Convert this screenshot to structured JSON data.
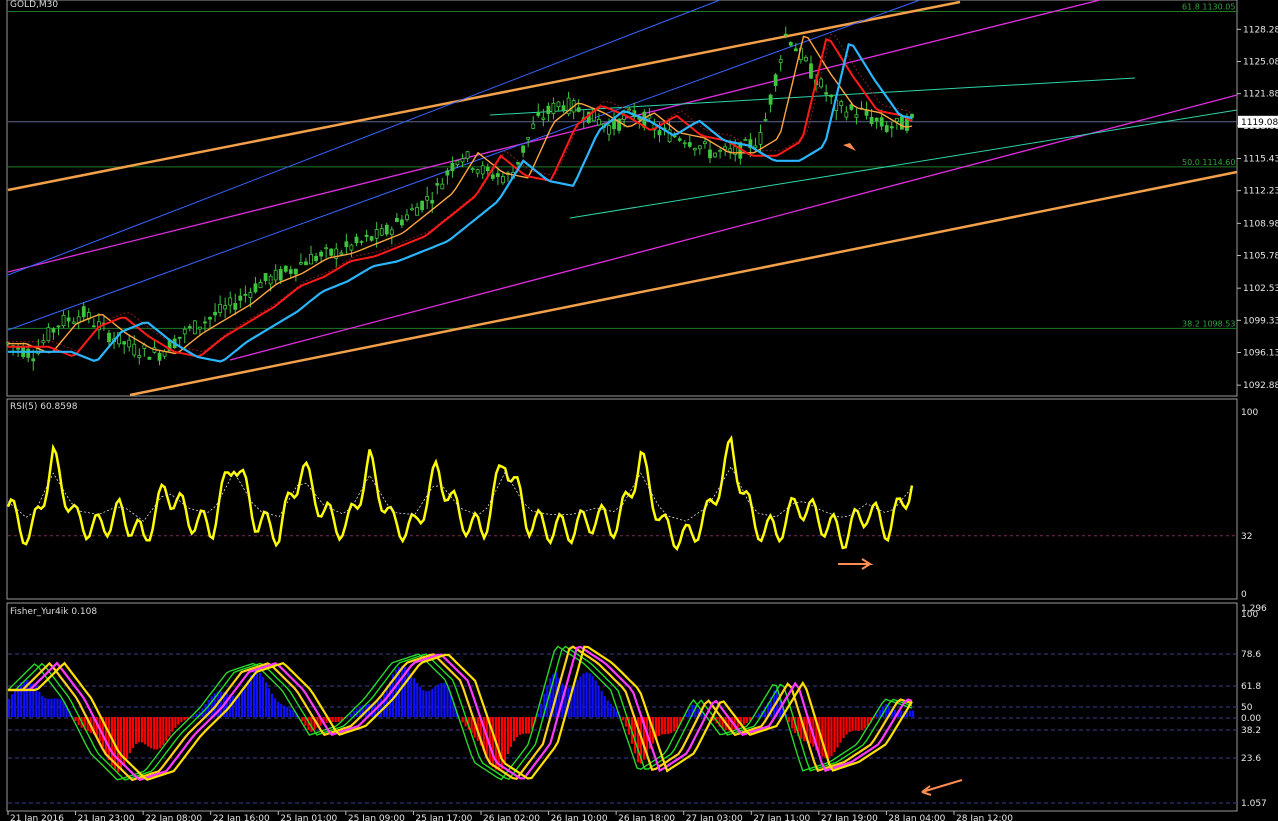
{
  "main": {
    "title": "GOLD,M30",
    "price_ticks": [
      "1128.28",
      "1125.08",
      "1121.88",
      "1118.68",
      "1115.43",
      "1112.23",
      "1108.98",
      "1105.78",
      "1102.53",
      "1099.33",
      "1096.13",
      "1092.88"
    ],
    "current_price": "1119.08",
    "fib_labels": [
      {
        "text": "61.8 1130.05",
        "price": 1130.05
      },
      {
        "text": "50.0 1114.60",
        "price": 1114.6
      },
      {
        "text": "38.2 1098.53",
        "price": 1098.53
      }
    ],
    "ylim": [
      1092.0,
      1131.0
    ]
  },
  "rsi": {
    "title": "RSI(5) 60.8598",
    "ticks": [
      "100",
      "32",
      "0"
    ]
  },
  "fisher": {
    "title": "Fisher_Yur4ik 0.108",
    "ticks": [
      "1.296",
      "100",
      "78.6",
      "61.8",
      "50",
      "0.00",
      "38.2",
      "23.6",
      "1.057"
    ]
  },
  "time_axis": [
    "21 Jan 2016",
    "21 Jan 23:00",
    "22 Jan 08:00",
    "22 Jan 16:00",
    "25 Jan 01:00",
    "25 Jan 09:00",
    "25 Jan 17:00",
    "26 Jan 02:00",
    "26 Jan 10:00",
    "26 Jan 18:00",
    "27 Jan 03:00",
    "27 Jan 11:00",
    "27 Jan 19:00",
    "28 Jan 04:00",
    "28 Jan 12:00"
  ],
  "colors": {
    "candle": "#3ec43e",
    "ema_red": "#ff1a1a",
    "ema_blue": "#2ab6ff",
    "ema_orange": "#ffa640",
    "channel_orange": "#f2a04a",
    "channel_magenta": "#e02ee0",
    "channel_blue": "#3a64ff",
    "channel_teal": "#2fd3a8",
    "rsi_line": "#ffff00",
    "fisher_pos": "#1010ff",
    "fisher_neg": "#ff0000",
    "arrow": "#ff8c50"
  },
  "chart_data": [
    {
      "type": "line",
      "title": "GOLD,M30",
      "ylim": [
        1092.0,
        1131.0
      ],
      "series": [
        {
          "values": [
            1097,
            1096,
            1099,
            1100,
            1098,
            1096.5,
            1096,
            1098,
            1099.5,
            1101,
            1103,
            1104,
            1105.5,
            1106,
            1107,
            1108,
            1110,
            1112,
            1116,
            1114,
            1113.5,
            1119,
            1121,
            1120,
            1118.5,
            1120,
            1118,
            1117.5,
            1116,
            1116,
            1117.5,
            1128,
            1124,
            1120.5,
            1120,
            1118.5,
            1119.1
          ]
        }
      ]
    },
    {
      "type": "line",
      "title": "RSI(5) 60.8598",
      "ylim": [
        0,
        100
      ],
      "series": [
        {
          "values": [
            48,
            30,
            74,
            40,
            36,
            45,
            30,
            58,
            42,
            36,
            75,
            40,
            34,
            70,
            44,
            35,
            72,
            38,
            36,
            68,
            42,
            34,
            75,
            40,
            36,
            36,
            42,
            38,
            74,
            36,
            30,
            44,
            80,
            38,
            34,
            50,
            40,
            32,
            46,
            36,
            61
          ]
        }
      ]
    },
    {
      "type": "bar",
      "title": "Fisher_Yur4ik 0.108",
      "ylim": [
        -1.2,
        1.3
      ],
      "series": [
        {
          "values": [
            0.3,
            0.6,
            0.2,
            -0.4,
            -0.7,
            -0.6,
            -0.2,
            0.1,
            0.5,
            0.6,
            0.3,
            -0.2,
            -0.1,
            0.2,
            0.6,
            0.7,
            0.4,
            -0.5,
            -0.7,
            -0.3,
            0.8,
            0.6,
            0.3,
            -0.6,
            -0.4,
            0.2,
            -0.2,
            -0.1,
            0.4,
            -0.6,
            -0.5,
            -0.3,
            0.2,
            0.1
          ]
        }
      ]
    }
  ]
}
